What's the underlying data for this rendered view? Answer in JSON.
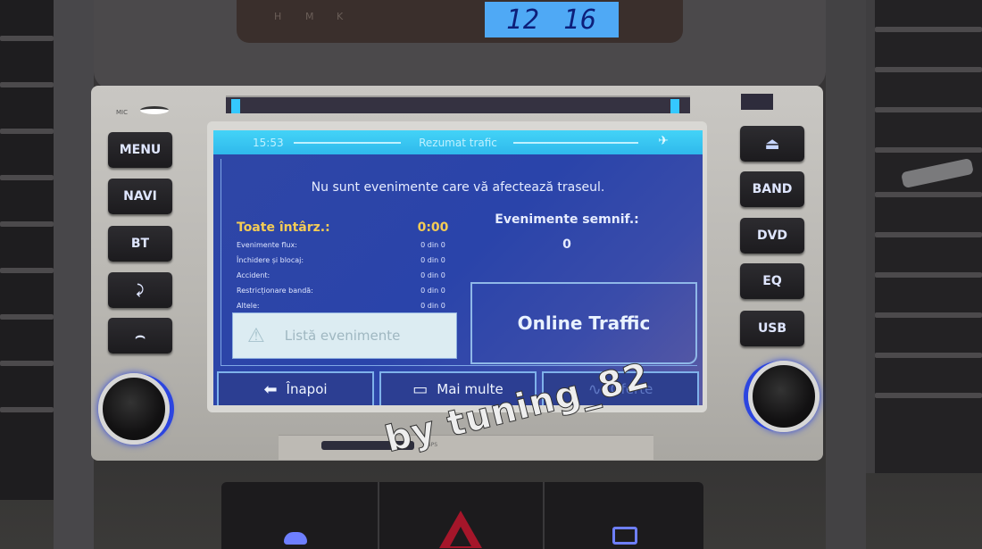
{
  "dashboard": {
    "clock_panel": {
      "labels": [
        "H",
        "M",
        "K"
      ],
      "clock_hours": "12",
      "clock_minutes": "16"
    },
    "mic_label": "MIC"
  },
  "head_unit": {
    "left_buttons": [
      {
        "label": "MENU",
        "name": "menu-button"
      },
      {
        "label": "NAVI",
        "name": "navi-button"
      },
      {
        "label": "BT",
        "name": "bt-button"
      },
      {
        "label": "",
        "icon": "phone-answer-icon",
        "name": "call-answer-button"
      },
      {
        "label": "",
        "icon": "phone-hangup-icon",
        "name": "call-hangup-button"
      }
    ],
    "right_buttons": [
      {
        "label": "",
        "icon": "eject-icon",
        "name": "eject-button"
      },
      {
        "label": "BAND",
        "name": "band-button"
      },
      {
        "label": "DVD",
        "name": "dvd-button"
      },
      {
        "label": "EQ",
        "name": "eq-button"
      },
      {
        "label": "USB",
        "name": "usb-button"
      }
    ],
    "icons": {
      "phone_answer": "⤸",
      "phone_hangup": "⌢",
      "eject": "⏏"
    },
    "gps_label": "GPS"
  },
  "screen": {
    "title_bar": {
      "time": "15:53",
      "title": "Rezumat trafic",
      "gps_icon": "✈"
    },
    "summary_message": "Nu sunt evenimente care vă afectează traseul.",
    "delays": {
      "total_label": "Toate întârz.:",
      "total_value": "0:00",
      "rows": [
        {
          "label": "Evenimente flux:",
          "value": "0 din 0"
        },
        {
          "label": "Închidere și blocaj:",
          "value": "0 din 0"
        },
        {
          "label": "Accident:",
          "value": "0 din 0"
        },
        {
          "label": "Restricționare bandă:",
          "value": "0 din 0"
        },
        {
          "label": "Altele:",
          "value": "0 din 0"
        }
      ]
    },
    "significant_events": {
      "label": "Evenimente semnif.:",
      "value": "0"
    },
    "event_list_button": {
      "label": "Listă evenimente",
      "icon": "⚠",
      "enabled": false
    },
    "online_traffic_button": {
      "label": "Online Traffic"
    },
    "bottom_nav": {
      "back": {
        "label": "Înapoi",
        "icon": "⬅"
      },
      "more": {
        "label": "Mai multe",
        "icon": "▭"
      },
      "offers": {
        "label": "Oferte",
        "icon": "∿",
        "enabled": false
      }
    }
  },
  "watermark": "by tuning_82",
  "colors": {
    "screen_bg": "#2c45a8",
    "title_bar": "#38c6f2",
    "delay_total": "#f4cc55",
    "clock_lcd": "#4fa9f5",
    "knob_ring": "#2c45e0",
    "hazard": "#a5162a"
  }
}
